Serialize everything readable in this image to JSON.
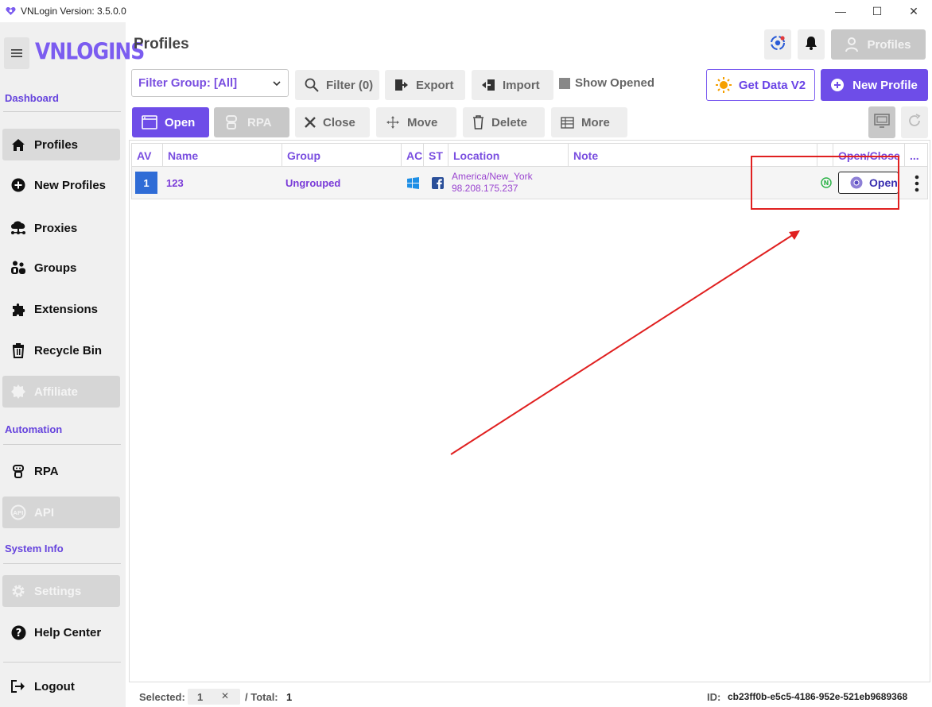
{
  "window": {
    "title": "VNLogin Version: 3.5.0.0",
    "controls": {
      "minimize": "—",
      "maximize": "☐",
      "close": "✕"
    }
  },
  "sidebar": {
    "menu_icon": "hamburger-icon",
    "logo": "VNLOGINS",
    "sections": {
      "dashboard": "Dashboard",
      "automation": "Automation",
      "system_info": "System Info"
    },
    "items": [
      {
        "label": "Profiles",
        "icon": "home-icon",
        "state": "active"
      },
      {
        "label": "New Profiles",
        "icon": "plus-circle-icon",
        "state": "normal"
      },
      {
        "label": "Proxies",
        "icon": "cloud-network-icon",
        "state": "normal"
      },
      {
        "label": "Groups",
        "icon": "people-icon",
        "state": "normal"
      },
      {
        "label": "Extensions",
        "icon": "puzzle-icon",
        "state": "normal"
      },
      {
        "label": "Recycle Bin",
        "icon": "trash-icon",
        "state": "normal"
      },
      {
        "label": "Affiliate",
        "icon": "badge-icon",
        "state": "disabled"
      },
      {
        "label": "RPA",
        "icon": "robot-icon",
        "state": "normal"
      },
      {
        "label": "API",
        "icon": "api-icon",
        "state": "disabled"
      },
      {
        "label": "Settings",
        "icon": "gear-icon",
        "state": "disabled"
      },
      {
        "label": "Help Center",
        "icon": "question-icon",
        "state": "normal"
      },
      {
        "label": "Logout",
        "icon": "logout-icon",
        "state": "normal"
      }
    ]
  },
  "header": {
    "title": "Profiles",
    "profiles_button": "Profiles"
  },
  "toolbar": {
    "filter_group": "Filter Group: [All]",
    "filter": "Filter (0)",
    "export": "Export",
    "import": "Import",
    "show_opened": "Show Opened",
    "get_data": "Get Data V2",
    "new_profile": "New Profile",
    "open": "Open",
    "rpa": "RPA",
    "close": "Close",
    "move": "Move",
    "delete": "Delete",
    "more": "More"
  },
  "table": {
    "columns": [
      "AV",
      "Name",
      "Group",
      "AC",
      "ST",
      "Location",
      "Note",
      "",
      "Open/Close",
      "..."
    ],
    "rows": [
      {
        "av": "1",
        "name": "123",
        "group": "Ungrouped",
        "ac_icon": "windows-icon",
        "st_icon": "facebook-icon",
        "location_city": "America/New_York",
        "location_ip": "98.208.175.237",
        "note": "",
        "status_icon": "status-n-icon",
        "open_label": "Open"
      }
    ]
  },
  "status": {
    "selected_label": "Selected:",
    "selected_value": "1",
    "clear": "✕",
    "total_label": "/ Total:",
    "total_value": "1",
    "id_label": "ID:",
    "id_value": "cb23ff0b-e5c5-4186-952e-521eb9689368"
  },
  "colors": {
    "accent": "#6e4de8",
    "link_purple": "#7a4fe0",
    "annotation_red": "#e02020",
    "av_blue": "#2f6cd6"
  }
}
